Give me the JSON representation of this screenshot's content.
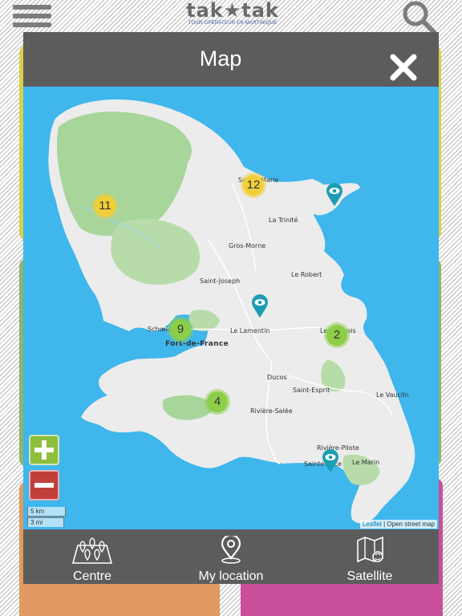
{
  "app": {
    "logo_text": "tak★tak",
    "logo_tagline": "TOUR-OPÉRATEUR EN MARTINIQUE"
  },
  "modal": {
    "title": "Map",
    "close_icon": "close-icon"
  },
  "map": {
    "places": [
      {
        "name": "Sainte-Marie"
      },
      {
        "name": "La Trinité"
      },
      {
        "name": "Gros-Morne"
      },
      {
        "name": "Le Robert"
      },
      {
        "name": "Saint-Joseph"
      },
      {
        "name": "Schœlcher"
      },
      {
        "name": "Le Lamentin"
      },
      {
        "name": "Le François"
      },
      {
        "name": "Fort-de-France"
      },
      {
        "name": "Ducos"
      },
      {
        "name": "Saint-Esprit"
      },
      {
        "name": "Le Vauclin"
      },
      {
        "name": "Rivière-Salée"
      },
      {
        "name": "Rivière-Pilote"
      },
      {
        "name": "Sainte-Luce"
      },
      {
        "name": "Le Marin"
      }
    ],
    "clusters": [
      {
        "count": "11",
        "color": "#f0cf3a"
      },
      {
        "count": "12",
        "color": "#f0cf3a"
      },
      {
        "count": "9",
        "color": "#8dce48"
      },
      {
        "count": "2",
        "color": "#8dce48"
      },
      {
        "count": "4",
        "color": "#8dce48"
      }
    ],
    "markers": [
      "eye-marker-icon",
      "eye-marker-icon",
      "eye-marker-icon"
    ],
    "zoom_in_icon": "plus-icon",
    "zoom_out_icon": "minus-icon",
    "scale_km": "5 km",
    "scale_mi": "3 mi",
    "attribution_leaflet": "Leaflet",
    "attribution_sep": " | ",
    "attribution_osm": "Open street map"
  },
  "toolbar": {
    "centre_label": "Centre",
    "location_label": "My location",
    "satellite_label": "Satellite"
  },
  "colors": {
    "sea": "#3fb6ec",
    "land": "#ececec",
    "forest": "#a8d59a",
    "modal": "#5c5c5c"
  }
}
